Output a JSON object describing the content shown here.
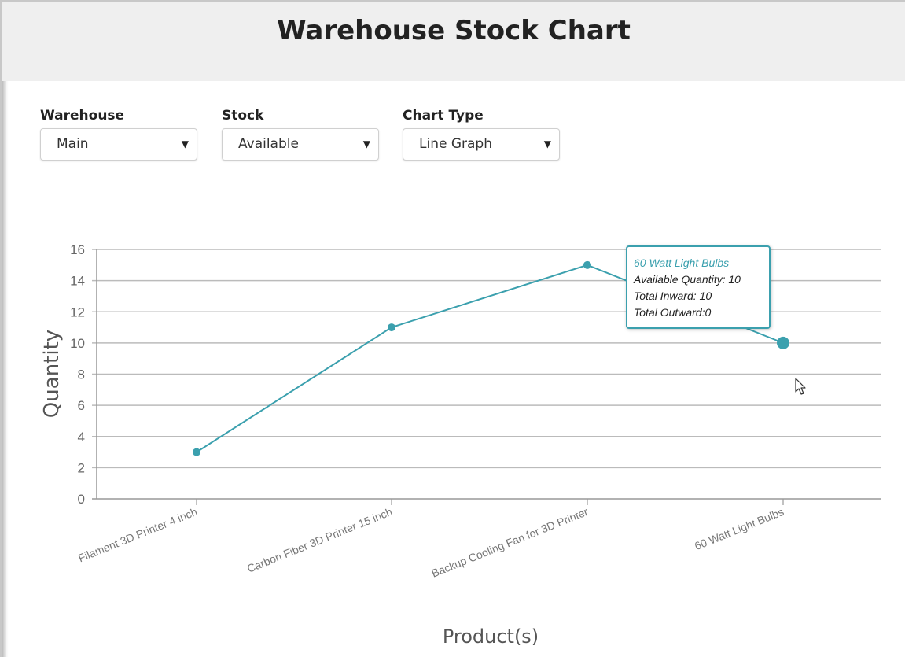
{
  "page": {
    "title": "Warehouse Stock Chart"
  },
  "filters": {
    "warehouse": {
      "label": "Warehouse",
      "value": "Main"
    },
    "stock": {
      "label": "Stock",
      "value": "Available"
    },
    "chart_type": {
      "label": "Chart Type",
      "value": "Line Graph"
    }
  },
  "chart_data": {
    "type": "line",
    "title": "",
    "xlabel": "Product(s)",
    "ylabel": "Quantity",
    "categories": [
      "Filament 3D Printer 4 inch",
      "Carbon Fiber 3D Printer 15 inch",
      "Backup Cooling Fan for 3D Printer",
      "60 Watt Light Bulbs"
    ],
    "series": [
      {
        "values": [
          3,
          11,
          15,
          10
        ]
      }
    ],
    "ylim": [
      0,
      16
    ],
    "yticks": [
      0,
      2,
      4,
      6,
      8,
      10,
      12,
      14,
      16
    ],
    "grid": true,
    "color": "#3ba0ae"
  },
  "tooltip": {
    "title": "60 Watt Light Bulbs",
    "line1": "Available Quantity: 10",
    "line2": "Total Inward: 10",
    "line3": "Total Outward:0"
  }
}
